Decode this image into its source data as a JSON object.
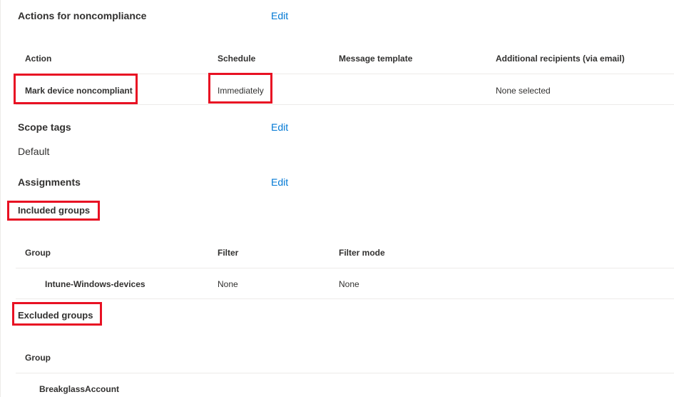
{
  "noncompliance": {
    "title": "Actions for noncompliance",
    "edit_label": "Edit",
    "columns": [
      "Action",
      "Schedule",
      "Message template",
      "Additional recipients (via email)"
    ],
    "rows": [
      {
        "action": "Mark device noncompliant",
        "schedule": "Immediately",
        "message_template": "",
        "recipients": "None selected"
      }
    ]
  },
  "scope_tags": {
    "title": "Scope tags",
    "edit_label": "Edit",
    "value": "Default"
  },
  "assignments": {
    "title": "Assignments",
    "edit_label": "Edit",
    "included": {
      "title": "Included groups",
      "columns": [
        "Group",
        "Filter",
        "Filter mode"
      ],
      "rows": [
        {
          "group": "Intune-Windows-devices",
          "filter": "None",
          "filter_mode": "None"
        }
      ]
    },
    "excluded": {
      "title": "Excluded groups",
      "columns": [
        "Group"
      ],
      "rows": [
        {
          "group": "BreakglassAccount"
        }
      ]
    }
  },
  "colors": {
    "accent_link": "#0078d4",
    "highlight_border": "#e81123",
    "divider": "#edebe9",
    "text": "#323130"
  }
}
